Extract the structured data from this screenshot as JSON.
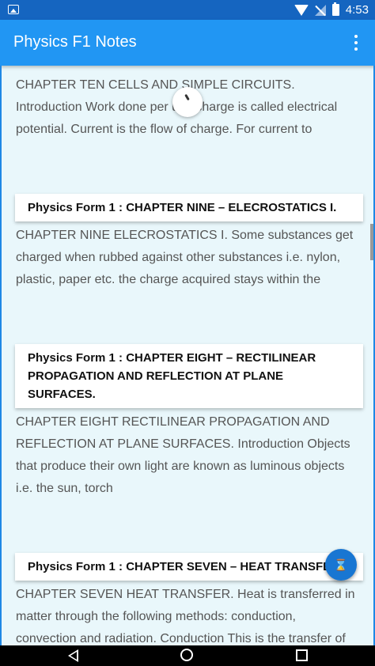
{
  "status_bar": {
    "time": "4:53"
  },
  "app_bar": {
    "title": "Physics F1 Notes"
  },
  "articles": [
    {
      "title": "",
      "excerpt": "CHAPTER TEN CELLS AND SIMPLE CIRCUITS. Introduction Work done per unit charge is called electrical potential. Current is the flow of charge. For current to"
    },
    {
      "title": "Physics Form 1 : CHAPTER NINE – ELECROSTATICS I.",
      "excerpt": "CHAPTER NINE ELECROSTATICS I.   Some substances get charged when rubbed against other substances i.e. nylon, plastic, paper etc. the charge acquired stays within the"
    },
    {
      "title": "Physics Form 1 : CHAPTER EIGHT – RECTILINEAR PROPAGATION AND REFLECTION AT PLANE SURFACES.",
      "excerpt": "CHAPTER EIGHT RECTILINEAR PROPAGATION AND REFLECTION AT PLANE SURFACES. Introduction Objects that produce their own light are known as luminous objects i.e. the sun, torch"
    },
    {
      "title": "Physics Form 1 : CHAPTER SEVEN – HEAT TRANSFER",
      "excerpt": "CHAPTER SEVEN HEAT TRANSFER. Heat is transferred in matter through the following methods: conduction, convection and radiation. Conduction This is the transfer of"
    }
  ],
  "fab": {
    "icon": "hourglass-icon",
    "glyph": "⌛"
  },
  "colors": {
    "status_bar": "#1565c0",
    "app_bar": "#2196f3",
    "background": "#e9f7fb",
    "fab": "#1976d2"
  }
}
